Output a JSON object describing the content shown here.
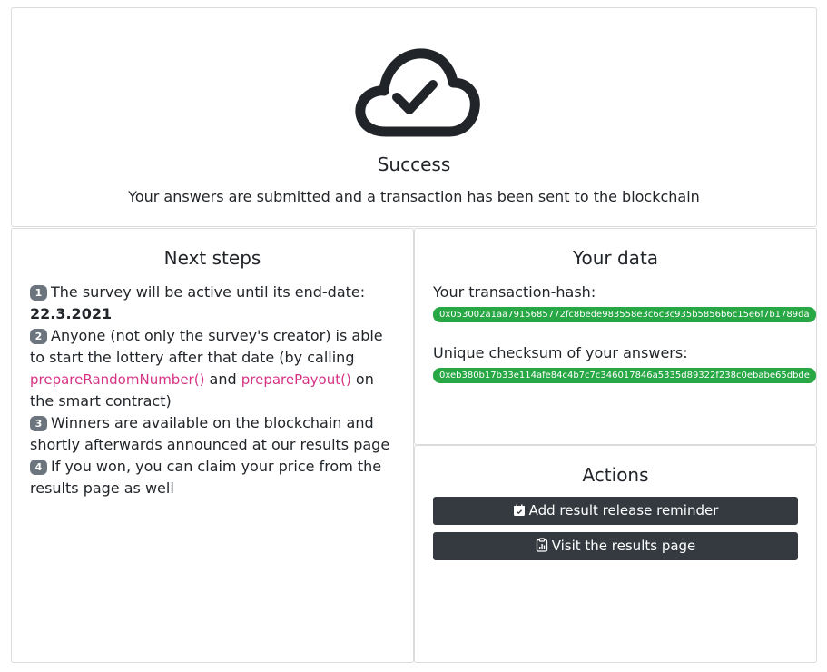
{
  "success": {
    "title": "Success",
    "message": "Your answers are submitted and a transaction has been sent to the blockchain"
  },
  "next_steps": {
    "title": "Next steps",
    "steps": [
      {
        "num": "1",
        "text": "The survey will be active until its end-date:",
        "date": "22.3.2021"
      },
      {
        "num": "2",
        "text_a": "Anyone (not only the survey's creator) is able to start the lottery after that date (by calling",
        "code_a": "prepareRandomNumber()",
        "text_b": "and",
        "code_b": "preparePayout()",
        "text_c": "on the smart contract)"
      },
      {
        "num": "3",
        "text": "Winners are available on the blockchain and shortly afterwards announced at our results page"
      },
      {
        "num": "4",
        "text": "If you won, you can claim your price from the results page as well"
      }
    ]
  },
  "your_data": {
    "title": "Your data",
    "hash_label": "Your transaction-hash:",
    "hash_value": "0x053002a1aa7915685772fc8bede983558e3c6c3c935b5856b6c15e6f7b1789da",
    "checksum_label": "Unique checksum of your answers:",
    "checksum_value": "0xeb380b17b33e114afe84c4b7c7c346017846a5335d89322f238c0ebabe65dbde"
  },
  "actions": {
    "title": "Actions",
    "reminder_label": "Add result release reminder",
    "results_label": "Visit the results page"
  },
  "colors": {
    "badge": "#28a745",
    "button": "#343a40",
    "code": "#d63384",
    "step_badge": "#6c757d"
  },
  "icons": {
    "hero": "cloud-check-icon",
    "reminder": "calendar-check-icon",
    "results": "clipboard-data-icon"
  }
}
